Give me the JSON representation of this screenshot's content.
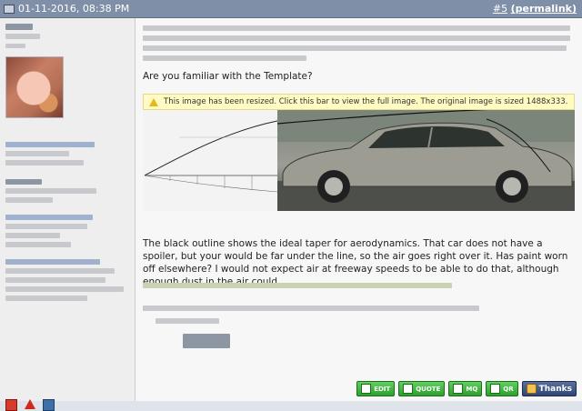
{
  "post": {
    "date": "01-11-2016, 08:38 PM",
    "number": "#5",
    "permalink": "(permalink)"
  },
  "content": {
    "question": "Are you familiar with the Template?",
    "resize_notice": "This image has been resized. Click this bar to view the full image. The original image is sized 1488x333.",
    "body": "The black outline shows the ideal taper for aerodynamics. That car does not have a spoiler, but your would be far under the line, so the air goes right over it. Has paint worn off elsewhere? I would not expect air at freeway speeds to be able to do that, although enough dust in the air could."
  },
  "buttons": {
    "edit": "EDIT",
    "quote": "QUOTE",
    "mq": "MQ",
    "qr": "QR",
    "thanks": "Thanks"
  },
  "icons": {
    "post": "post-icon",
    "report": "report-icon",
    "warn": "warning-icon",
    "pm": "private-message-icon",
    "resize": "warning-triangle-icon"
  },
  "colors": {
    "header": "#7f8fa7",
    "sidebar": "#eeeeee",
    "content": "#f7f7f7",
    "resize_bar": "#fffbc2",
    "button_green": "#2e9e2e",
    "thanks_blue": "#2f4675"
  }
}
